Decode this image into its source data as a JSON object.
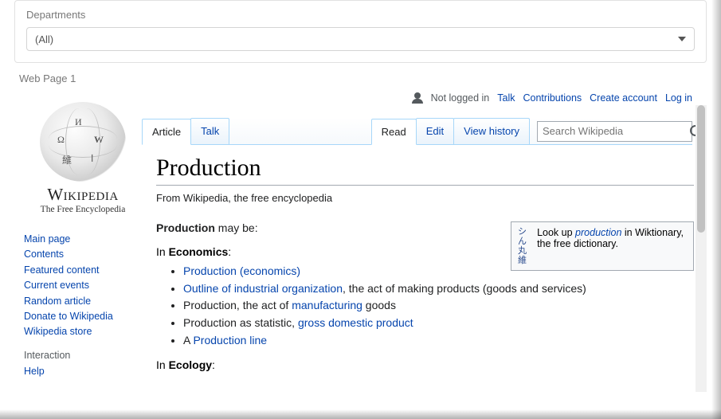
{
  "filter": {
    "label": "Departments",
    "value": "(All)"
  },
  "page_label": "Web Page 1",
  "toplinks": {
    "not_logged_in": "Not logged in",
    "talk": "Talk",
    "contributions": "Contributions",
    "create_account": "Create account",
    "log_in": "Log in"
  },
  "logo": {
    "wordmark": "Wikipedia",
    "tagline": "The Free Encyclopedia"
  },
  "sidebar": {
    "items": [
      "Main page",
      "Contents",
      "Featured content",
      "Current events",
      "Random article",
      "Donate to Wikipedia",
      "Wikipedia store"
    ],
    "interaction_heading": "Interaction",
    "interaction_items": [
      "Help"
    ]
  },
  "tabs": {
    "left": [
      {
        "label": "Article",
        "active": true
      },
      {
        "label": "Talk",
        "active": false
      }
    ],
    "right": [
      {
        "label": "Read",
        "active": true
      },
      {
        "label": "Edit",
        "active": false
      },
      {
        "label": "View history",
        "active": false
      }
    ]
  },
  "search": {
    "placeholder": "Search Wikipedia"
  },
  "article": {
    "title": "Production",
    "from": "From Wikipedia, the free encyclopedia",
    "wikt": {
      "pre": "Look up ",
      "term": "production",
      "post": " in Wiktionary, the free dictionary."
    },
    "lead_strong": "Production",
    "lead_rest": " may be:",
    "sec1_pre": "In ",
    "sec1_b": "Economics",
    "sec1_post": ":",
    "bullets1": {
      "b1": "Production (economics)",
      "b2a": "Outline of industrial organization",
      "b2b": ", the act of making products (goods and services)",
      "b3a": "Production, the act of ",
      "b3b": "manufacturing",
      "b3c": " goods",
      "b4a": "Production as statistic, ",
      "b4b": "gross domestic product",
      "b5a": "A ",
      "b5b": "Production line"
    },
    "sec2_pre": "In ",
    "sec2_b": "Ecology",
    "sec2_post": ":"
  }
}
